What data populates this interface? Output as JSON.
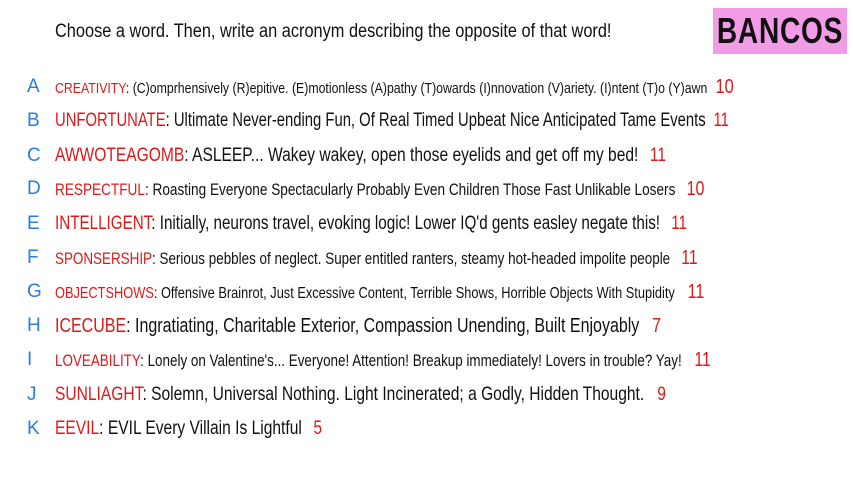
{
  "header": "Choose a word. Then, write an acronym describing the opposite of that word!",
  "logo": "BANCOS",
  "entries": [
    {
      "letter": "A",
      "word": "CREATIVITY",
      "acronym": "(C)omprhensively (R)epitive. (E)motionless (A)pathy (T)owards  (I)nnovation (V)ariety. (I)ntent (T)o (Y)awn",
      "score": "10"
    },
    {
      "letter": "B",
      "word": "UNFORTUNATE",
      "acronym": "Ultimate Never-ending Fun, Of Real Timed Upbeat Nice Anticipated Tame Events",
      "score": "11"
    },
    {
      "letter": "C",
      "word": "AWWOTEAGOMB",
      "acronym": "ASLEEP... Wakey wakey, open those eyelids and get off my bed!",
      "score": "11"
    },
    {
      "letter": "D",
      "word": "RESPECTFUL",
      "acronym": "Roasting Everyone Spectacularly Probably  Even Children  Those Fast Unlikable Losers",
      "score": "10"
    },
    {
      "letter": "E",
      "word": "INTELLIGENT",
      "acronym": "Initially, neurons travel, evoking logic! Lower IQ'd gents easley negate this!",
      "score": "11"
    },
    {
      "letter": "F",
      "word": "SPONSERSHIP",
      "acronym": "Serious pebbles of neglect. Super entitled ranters, steamy hot-headed impolite people",
      "score": "11"
    },
    {
      "letter": "G",
      "word": "OBJECTSHOWS",
      "acronym": "Offensive Brainrot, Just Excessive Content, Terrible Shows, Horrible Objects With Stupidity",
      "score": "11"
    },
    {
      "letter": "H",
      "word": "ICECUBE",
      "acronym": "Ingratiating, Charitable Exterior, Compassion Unending, Built Enjoyably",
      "score": "7"
    },
    {
      "letter": "I",
      "word": "LOVEABILITY",
      "acronym": "Lonely on Valentine's... Everyone! Attention! Breakup immediately! Lovers in trouble? Yay!",
      "score": "11"
    },
    {
      "letter": "J",
      "word": "SUNLIAGHT",
      "acronym": "Solemn, Universal Nothing. Light Incinerated; a Godly, Hidden Thought.",
      "score": "9"
    },
    {
      "letter": "K",
      "word": "EEVIL",
      "acronym": "EVIL Every Villain Is Lightful",
      "score": "5"
    }
  ],
  "colors": {
    "letter": "#2a7de1",
    "word": "#e01818",
    "score": "#e01818",
    "logo_bg": "#f29ce8"
  }
}
